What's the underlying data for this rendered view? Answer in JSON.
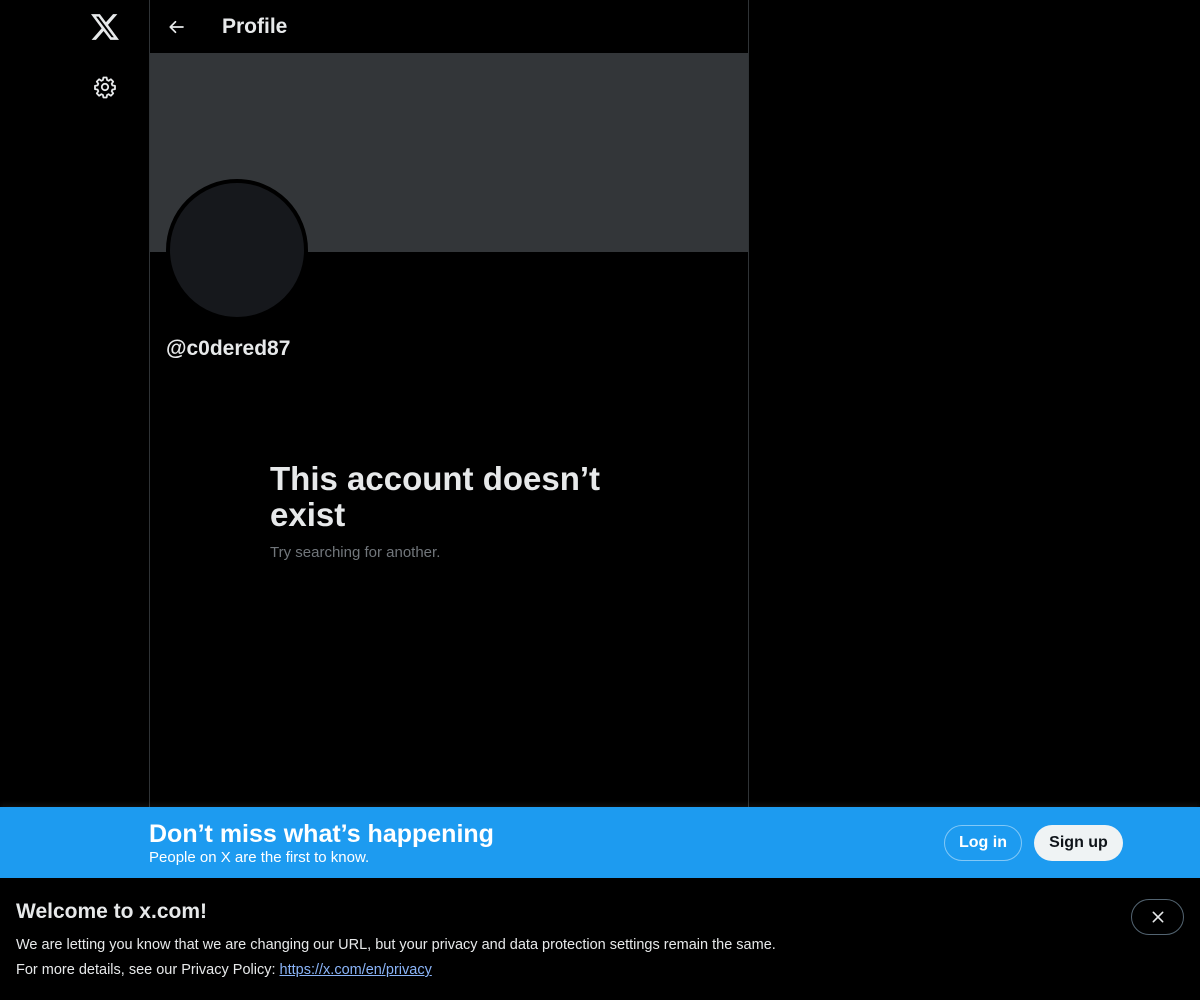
{
  "nav": {
    "logo_icon": "x-logo-icon",
    "settings_icon": "gear-icon"
  },
  "header": {
    "back_icon": "arrow-left-icon",
    "title": "Profile"
  },
  "profile": {
    "handle": "@c0dered87"
  },
  "empty_state": {
    "title": "This account doesn’t exist",
    "subtitle": "Try searching for another."
  },
  "signup_bar": {
    "title": "Don’t miss what’s happening",
    "subtitle": "People on X are the first to know.",
    "login_label": "Log in",
    "signup_label": "Sign up",
    "background_color": "#1d9bf0"
  },
  "notice": {
    "title": "Welcome to x.com!",
    "line1": "We are letting you know that we are changing our URL, but your privacy and data protection settings remain the same.",
    "line2_prefix": "For more details, see our Privacy Policy: ",
    "link_text": "https://x.com/en/privacy",
    "close_icon": "close-icon"
  },
  "colors": {
    "background": "#000000",
    "banner": "#333639",
    "text_primary": "#e7e9ea",
    "text_secondary": "#71767b",
    "accent": "#1d9bf0"
  }
}
